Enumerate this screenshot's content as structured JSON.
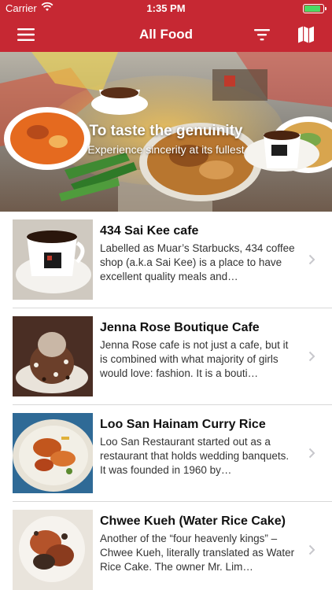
{
  "status_bar": {
    "carrier": "Carrier",
    "time": "1:35 PM",
    "battery_level": 0.85
  },
  "nav": {
    "title": "All Food",
    "menu_icon": "hamburger-menu-icon",
    "filter_icon": "filter-icon",
    "map_icon": "map-icon"
  },
  "hero": {
    "headline": "To taste the genuinity",
    "tagline": "Experience sincerity at its fullest"
  },
  "items": [
    {
      "name": "434 Sai Kee cafe",
      "description": "Labelled as Muar’s Starbucks, 434 coffee shop (a.k.a Sai Kee) is a place to have excellent quality meals and…"
    },
    {
      "name": "Jenna Rose Boutique Cafe",
      "description": "Jenna Rose cafe is not just a cafe, but it is combined with what majority of girls would love: fashion. It is a bouti…"
    },
    {
      "name": "Loo San Hainam Curry Rice",
      "description": "Loo San Restaurant started out as a restaurant that holds wedding banquets. It was founded in 1960 by…"
    },
    {
      "name": "Chwee Kueh (Water Rice Cake)",
      "description": "Another of the “four heavenly kings” – Chwee Kueh, literally translated as Water Rice Cake. The owner Mr. Lim…"
    }
  ],
  "colors": {
    "brand": "#c62833",
    "separator": "#d8d8d8",
    "chevron": "#c7c7cc"
  }
}
